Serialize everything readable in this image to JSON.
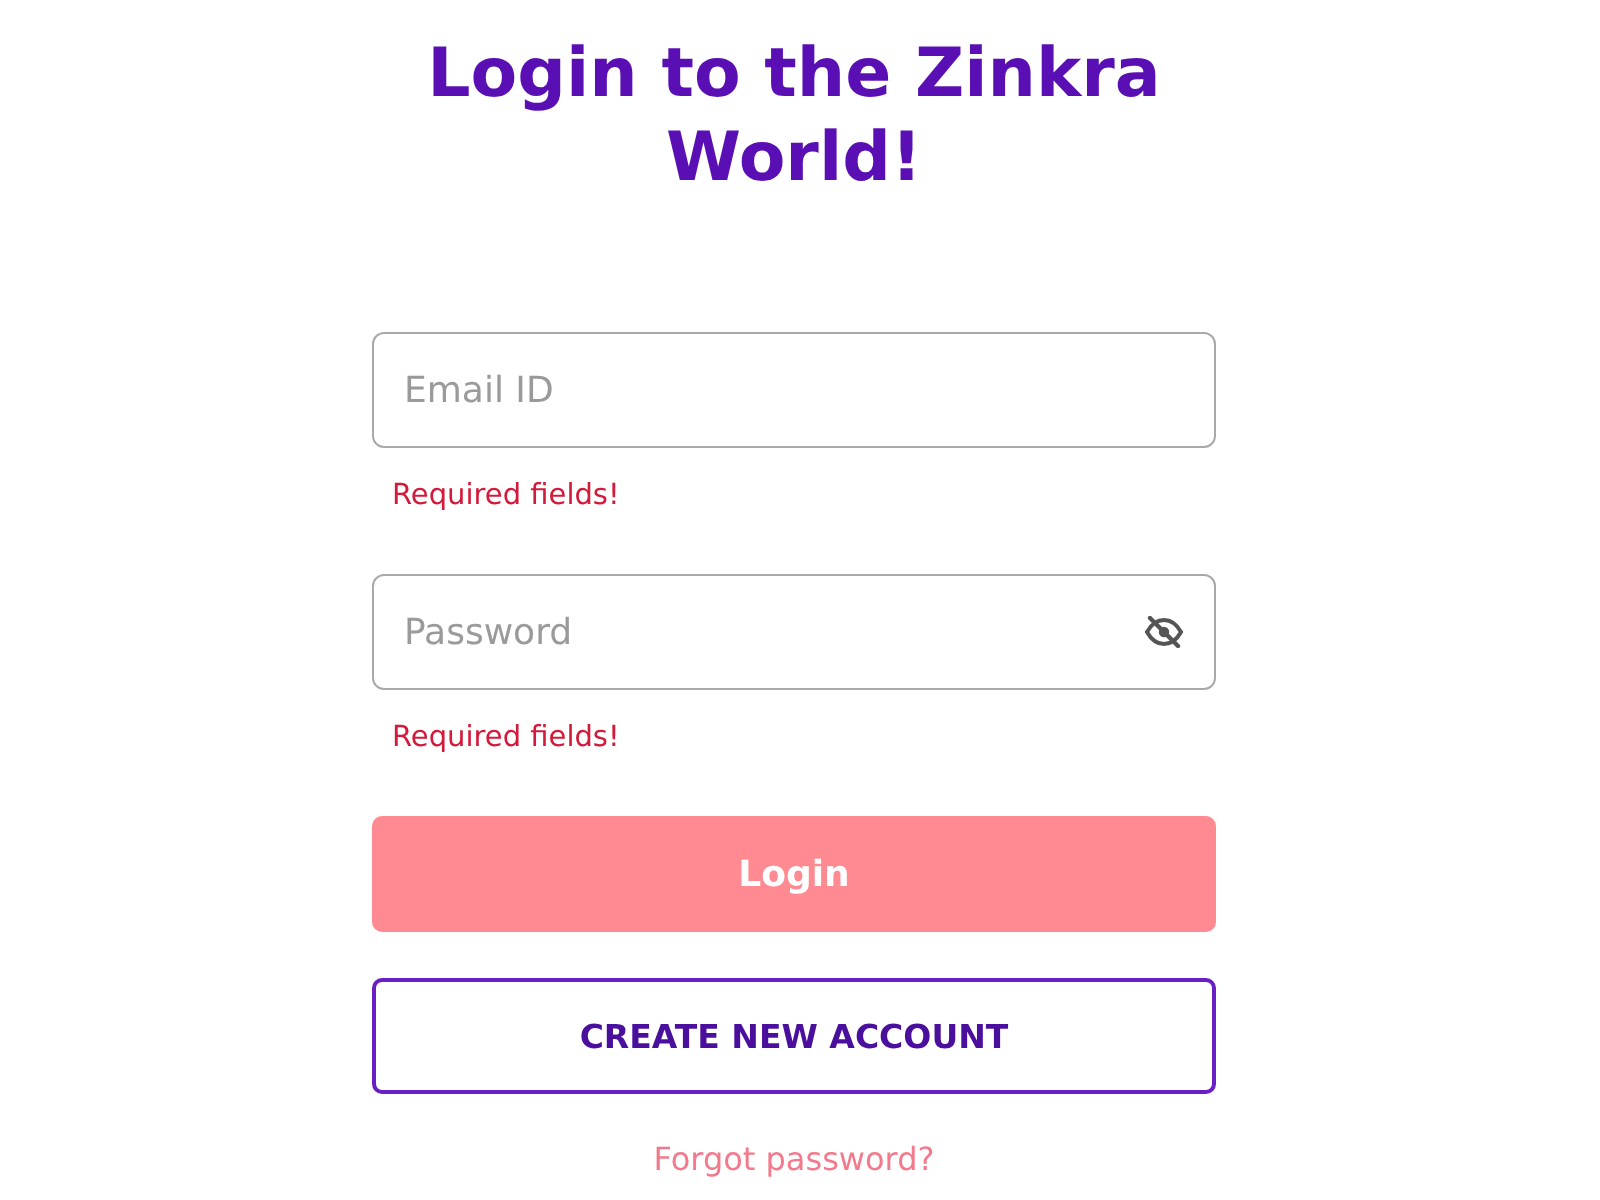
{
  "title": "Login to the Zinkra World!",
  "fields": [
    {
      "kind": "email",
      "placeholder": "Email ID",
      "error": "Required fields!"
    },
    {
      "kind": "password",
      "placeholder": "Password",
      "visible": false,
      "error": "Required fields!"
    }
  ],
  "login_button": {
    "label": "Login",
    "disabled": true
  },
  "create_account_button": {
    "label": "CREATE NEW ACCOUNT"
  },
  "forgot_password_link": {
    "label": "Forgot password?"
  }
}
